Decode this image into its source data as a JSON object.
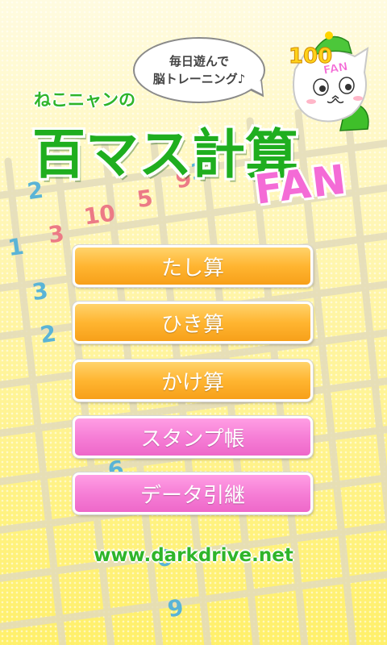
{
  "speech_bubble": {
    "line1": "毎日遊んで",
    "line2": "脳トレーニング♪"
  },
  "brand": {
    "subtitle": "ねこニャンの",
    "title": "百マス計算",
    "fan": "FAN"
  },
  "mascot": {
    "badge_number": "100",
    "badge_text": "FAN"
  },
  "background_numbers": [
    "2",
    "1",
    "3",
    "10",
    "5",
    "9",
    "1",
    "3",
    "2",
    "3",
    "6",
    "6",
    "9"
  ],
  "menu": [
    {
      "label": "たし算",
      "color": "#ffb531"
    },
    {
      "label": "ひき算",
      "color": "#ffb531"
    },
    {
      "label": "かけ算",
      "color": "#ffb531"
    },
    {
      "label": "スタンプ帳",
      "color": "#f67fd6"
    },
    {
      "label": "データ引継",
      "color": "#f67fd6"
    }
  ],
  "footer": {
    "url": "www.darkdrive.net"
  }
}
